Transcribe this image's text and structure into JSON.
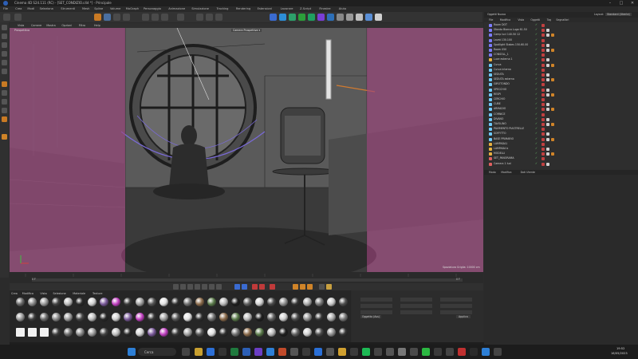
{
  "window": {
    "title": "Cinema 4D S24.111 (RC) - [SET_CONDIZIO.c4d *] - Principale"
  },
  "menu": [
    "File",
    "Crea",
    "Modi",
    "Seleziona",
    "Strumenti",
    "Mesh",
    "Spline",
    "Volume",
    "MoGraph",
    "Personaggio",
    "Animazione",
    "Simulazione",
    "Tracking",
    "Rendering",
    "Estensioni",
    "Lavorare",
    "Z-Script",
    "Finestre",
    "Aiuto"
  ],
  "right_top": {
    "search": "Oggetti Nuovo",
    "layout_label": "Layout:",
    "layout_value": "Standard (Utente)"
  },
  "viewport": {
    "menu": [
      "Vista",
      "Camere",
      "Mostra",
      "Opzioni",
      "Filtro",
      "Help"
    ],
    "title": "Prospettiva",
    "camera": "Camera Prospettiva ▾",
    "status": "Spaziatura Griglia: 10000 cm"
  },
  "timeline": {
    "start": "0 F",
    "end": "0 F"
  },
  "materials": {
    "menu": [
      "Crea",
      "Modifica",
      "Vista",
      "Selezione",
      "Materiale",
      "Texture"
    ]
  },
  "objects": {
    "tabs": [
      "File",
      "Modifica",
      "Vista",
      "Oggetti",
      "Tag",
      "Segnalibri"
    ],
    "rows": [
      {
        "name": "Room DOT",
        "color": "#7c7cff"
      },
      {
        "name": "Sfondo Bianco Luga 61.50",
        "color": "#7c7cff"
      },
      {
        "name": "Camp luci 140.50 12",
        "color": "#7c7cff"
      },
      {
        "name": "Lavat 130.100",
        "color": "#7c7cff"
      },
      {
        "name": "Spotlight Stakes 150-60.00",
        "color": "#7c7cff"
      },
      {
        "name": "Room 050",
        "color": "#7c7cff"
      },
      {
        "name": "CONSOLL_1",
        "color": "#7c7cff"
      },
      {
        "name": "Luce esterna 1",
        "color": "#e8b040"
      },
      {
        "name": "Curva",
        "color": "#6ecbff"
      },
      {
        "name": "Curva interna",
        "color": "#6ecbff"
      },
      {
        "name": "SEDUTA",
        "color": "#6ecbff"
      },
      {
        "name": "SEDUTA esterna",
        "color": "#6ecbff"
      },
      {
        "name": "GIROTONDO",
        "color": "#6ecbff"
      },
      {
        "name": "SPECCHIO",
        "color": "#6ecbff"
      },
      {
        "name": "RESPI",
        "color": "#6ecbff"
      },
      {
        "name": "CERCHIO",
        "color": "#6ecbff"
      },
      {
        "name": "CUBE",
        "color": "#6ecbff"
      },
      {
        "name": "ARMADIO",
        "color": "#6ecbff"
      },
      {
        "name": "CORNICE",
        "color": "#6ecbff"
      },
      {
        "name": "DIVANO",
        "color": "#6ecbff"
      },
      {
        "name": "TAVOLINO",
        "color": "#6ecbff"
      },
      {
        "name": "PAVIMENTO PIASTRELLE",
        "color": "#6ecbff"
      },
      {
        "name": "SOFFITTO",
        "color": "#6ecbff"
      },
      {
        "name": "BASE PRIMARIO",
        "color": "#6ecbff"
      },
      {
        "name": "LAMPADA1",
        "color": "#e8b040"
      },
      {
        "name": "LAMPADA b",
        "color": "#e8b040"
      },
      {
        "name": "MODELLI",
        "color": "#e8b040"
      },
      {
        "name": "SET_PANORAMA",
        "color": "#e06060"
      },
      {
        "name": "Camera 1 luci",
        "color": "#e06060"
      }
    ]
  },
  "attributes": {
    "tabs": [
      "Modo",
      "Modifica",
      "Dati Utente"
    ],
    "btn": "Applica",
    "dropdown": "Oggetto (Ass)"
  },
  "taskbar": {
    "search": "Cerca",
    "time": "19:52",
    "date": "16/05/2023"
  },
  "colors": {
    "pink_overlay": "#a0437e",
    "accent_blue": "#2d5fb6"
  }
}
